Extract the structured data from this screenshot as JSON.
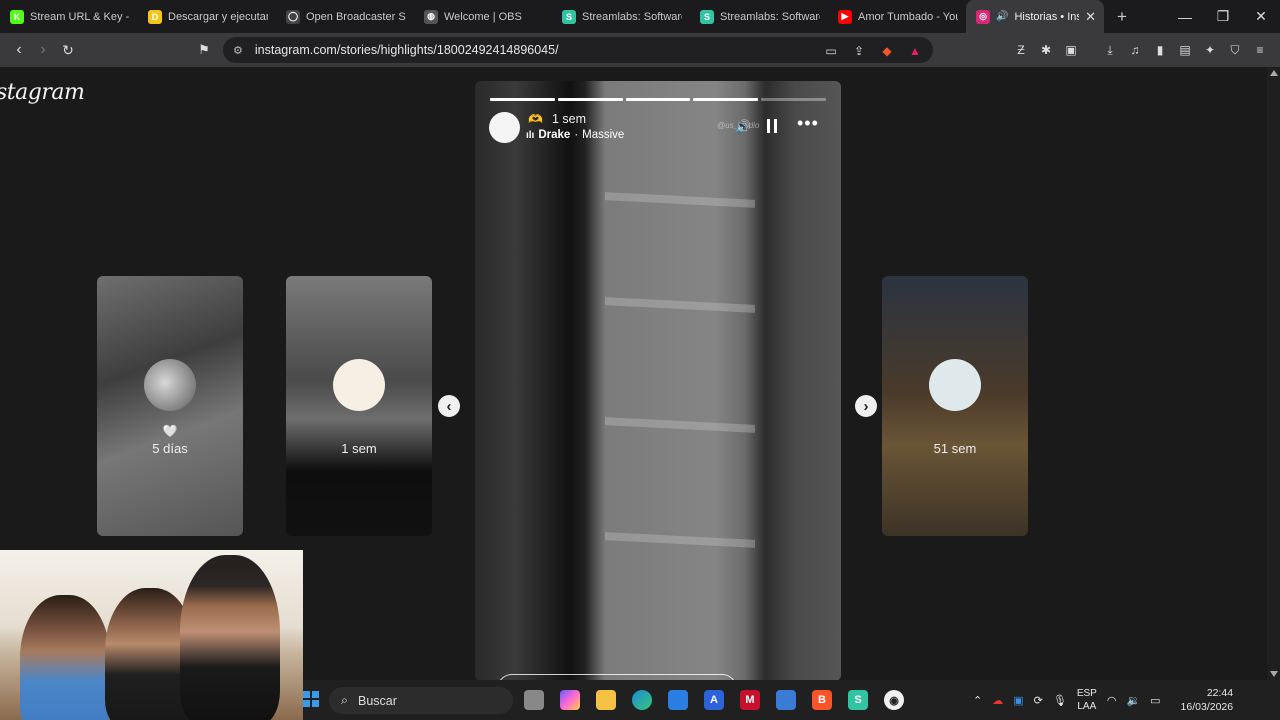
{
  "browser": {
    "tabs": [
      {
        "label": "Stream URL & Key - K",
        "favicon": "kick-icon",
        "color": "#53fc18",
        "glyph": "K"
      },
      {
        "label": "Descargar y ejecutar I",
        "favicon": "doc-icon",
        "color": "#f5c518",
        "glyph": "D"
      },
      {
        "label": "Open Broadcaster Sof",
        "favicon": "github-icon",
        "color": "#444444",
        "glyph": "◯"
      },
      {
        "label": "Welcome | OBS",
        "favicon": "globe-icon",
        "color": "#555555",
        "glyph": "◍"
      },
      {
        "label": "Streamlabs: Software",
        "favicon": "streamlabs-icon",
        "color": "#31c3a2",
        "glyph": "S"
      },
      {
        "label": "Streamlabs: Software",
        "favicon": "streamlabs-icon",
        "color": "#31c3a2",
        "glyph": "S"
      },
      {
        "label": "Amor Tumbado - You",
        "favicon": "youtube-icon",
        "color": "#ff0000",
        "glyph": "▶"
      },
      {
        "label": "Historias • Inst",
        "favicon": "instagram-icon",
        "color": "#d62976",
        "glyph": "◎",
        "active": true
      }
    ],
    "new_tab": "+",
    "window_controls": {
      "minimize": "—",
      "maximize": "❐",
      "close": "✕"
    },
    "url": "instagram.com/stories/highlights/18002492414896045/"
  },
  "instagram": {
    "logo_text": "stagram",
    "previews": [
      {
        "time": "5 días",
        "heart": "🤍"
      },
      {
        "time": "1 sem"
      },
      {
        "time": "51 sem"
      }
    ],
    "story": {
      "time": "1 sem",
      "hand_emoji": "🫶",
      "artist": "Drake",
      "separator": "·",
      "song": "Massive",
      "watermark": "@us_studio",
      "more": "•••",
      "progress_total": 5,
      "progress_done": 4
    },
    "nav": {
      "prev": "‹",
      "next": "›"
    }
  },
  "taskbar": {
    "search_placeholder": "Buscar",
    "lang_top": "ESP",
    "lang_bottom": "LAA",
    "time": "22:44",
    "date": "16/03/2026"
  }
}
